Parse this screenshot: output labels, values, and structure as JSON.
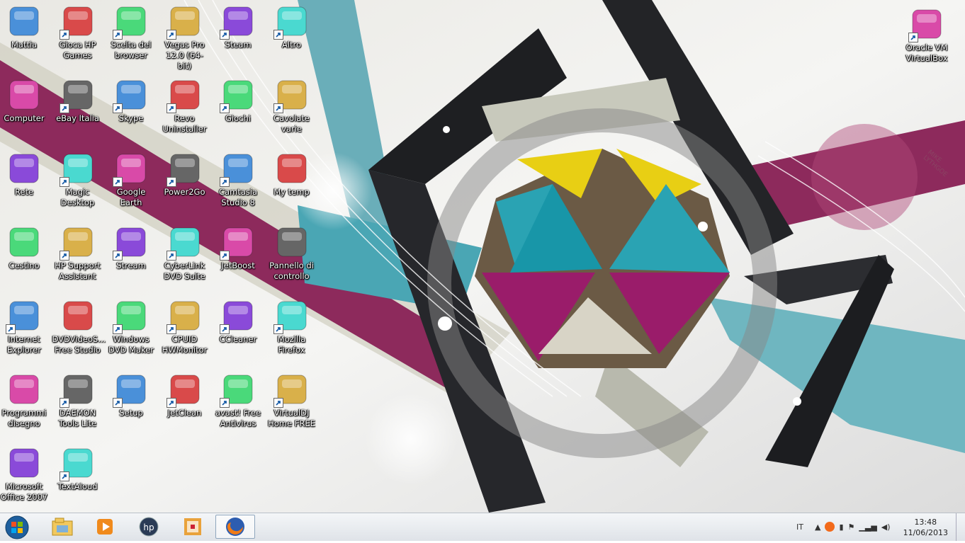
{
  "desktop": {
    "icons": [
      {
        "label": "Mattia",
        "icon": "user-folder-icon",
        "shortcut": false
      },
      {
        "label": "Gioca HP Games",
        "icon": "hp-games-icon",
        "shortcut": true
      },
      {
        "label": "Scelta del browser",
        "icon": "browser-choice-icon",
        "shortcut": true
      },
      {
        "label": "Vegas Pro 12.0 (64-bit)",
        "icon": "vegas-pro-icon",
        "shortcut": true
      },
      {
        "label": "Steam",
        "icon": "steam-icon",
        "shortcut": true
      },
      {
        "label": "Altro",
        "icon": "folder-icon",
        "shortcut": true
      },
      {
        "label": "Computer",
        "icon": "computer-icon",
        "shortcut": false
      },
      {
        "label": "eBay Italia",
        "icon": "ebay-icon",
        "shortcut": true
      },
      {
        "label": "Skype",
        "icon": "skype-icon",
        "shortcut": true
      },
      {
        "label": "Revo Uninstaller",
        "icon": "revo-uninstaller-icon",
        "shortcut": true
      },
      {
        "label": "Giochi",
        "icon": "games-play-icon",
        "shortcut": true
      },
      {
        "label": "Cavolate varie",
        "icon": "folder-icon",
        "shortcut": true
      },
      {
        "label": "Rete",
        "icon": "network-icon",
        "shortcut": false
      },
      {
        "label": "Magic Desktop",
        "icon": "magic-desktop-icon",
        "shortcut": true
      },
      {
        "label": "Google Earth",
        "icon": "google-earth-icon",
        "shortcut": true
      },
      {
        "label": "Power2Go",
        "icon": "power2go-icon",
        "shortcut": true
      },
      {
        "label": "Camtasia Studio 8",
        "icon": "camtasia-icon",
        "shortcut": true
      },
      {
        "label": "My temp",
        "icon": "my-temp-icon",
        "shortcut": false
      },
      {
        "label": "Cestino",
        "icon": "recycle-bin-icon",
        "shortcut": false
      },
      {
        "label": "HP Support Assistant",
        "icon": "hp-support-icon",
        "shortcut": true
      },
      {
        "label": "Stream",
        "icon": "stream-icon",
        "shortcut": true
      },
      {
        "label": "CyberLink DVD Suite",
        "icon": "cyberlink-icon",
        "shortcut": true
      },
      {
        "label": "JetBoost",
        "icon": "jetboost-icon",
        "shortcut": true
      },
      {
        "label": "Pannello di controllo",
        "icon": "control-panel-icon",
        "shortcut": false
      },
      {
        "label": "Internet Explorer",
        "icon": "internet-explorer-icon",
        "shortcut": true
      },
      {
        "label": "DVDVideoS... Free Studio",
        "icon": "dvdvideosoft-icon",
        "shortcut": false
      },
      {
        "label": "Windows DVD Maker",
        "icon": "dvd-maker-icon",
        "shortcut": true
      },
      {
        "label": "CPUID HWMonitor",
        "icon": "hwmonitor-icon",
        "shortcut": true
      },
      {
        "label": "CCleaner",
        "icon": "ccleaner-icon",
        "shortcut": true
      },
      {
        "label": "Mozilla Firefox",
        "icon": "firefox-icon",
        "shortcut": true
      },
      {
        "label": "Programmi disegno",
        "icon": "drawing-programs-icon",
        "shortcut": false
      },
      {
        "label": "DAEMON Tools Lite",
        "icon": "daemon-tools-icon",
        "shortcut": true
      },
      {
        "label": "Setup",
        "icon": "setup-icon",
        "shortcut": true
      },
      {
        "label": "JetClean",
        "icon": "jetclean-icon",
        "shortcut": true
      },
      {
        "label": "avast! Free Antivirus",
        "icon": "avast-icon",
        "shortcut": true
      },
      {
        "label": "VirtualDJ Home FREE",
        "icon": "virtualdj-icon",
        "shortcut": true
      },
      {
        "label": "Microsoft Office 2007",
        "icon": "document-icon",
        "shortcut": false
      },
      {
        "label": "TextAloud",
        "icon": "textaloud-icon",
        "shortcut": true
      },
      {
        "label": "Oracle VM VirtualBox",
        "icon": "virtualbox-icon",
        "shortcut": true
      }
    ],
    "wallpaper_signature": "MIKE LYTHGOE"
  },
  "taskbar": {
    "pinned": [
      "explorer-icon",
      "media-player-icon",
      "hp-icon",
      "control-icon",
      "firefox-icon"
    ],
    "language": "IT",
    "time": "13:48",
    "date": "11/06/2013"
  },
  "colors": {
    "magenta": "#8d2a5c",
    "teal": "#4aa6b4",
    "yellow": "#e8cf14",
    "dark": "#222428",
    "sand": "#c9c8b8"
  }
}
